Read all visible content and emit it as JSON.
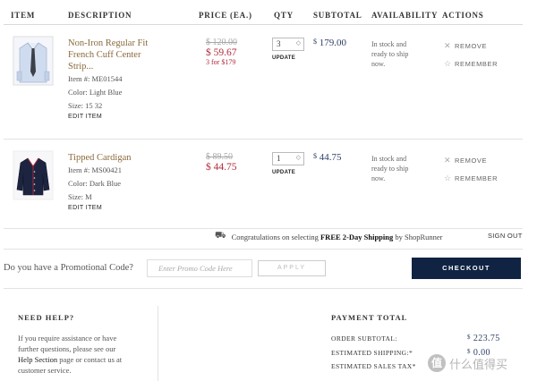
{
  "headers": {
    "item": "ITEM",
    "description": "DESCRIPTION",
    "price": "PRICE (EA.)",
    "qty": "QTY",
    "subtotal": "SUBTOTAL",
    "availability": "AVAILABILITY",
    "actions": "ACTIONS"
  },
  "items": [
    {
      "name_line1": "Non-Iron Regular Fit",
      "name_line2": "French Cuff Center",
      "name_line3": "Strip...",
      "item_no": "Item #: ME01544",
      "color": "Color: Light Blue",
      "size": "Size: 15 32",
      "edit": "EDIT ITEM",
      "old_price": "$ 120.00",
      "new_price": "$ 59.67",
      "deal": "3 for $179",
      "qty": "3",
      "update": "UPDATE",
      "subtotal": "179.00",
      "avail_line1": "In stock and",
      "avail_line2": "ready to ship",
      "avail_line3": "now.",
      "remove": "REMOVE",
      "remember": "REMEMBER"
    },
    {
      "name_line1": "Tipped Cardigan",
      "item_no": "Item #: MS00421",
      "color": "Color: Dark Blue",
      "size": "Size: M",
      "edit": "EDIT ITEM",
      "old_price": "$ 89.50",
      "new_price": "$ 44.75",
      "qty": "1",
      "update": "UPDATE",
      "subtotal": "44.75",
      "avail_line1": "In stock and",
      "avail_line2": "ready to ship",
      "avail_line3": "now.",
      "remove": "REMOVE",
      "remember": "REMEMBER"
    }
  ],
  "shoprunner": {
    "pre": "Congratulations on selecting",
    "bold": "FREE 2-Day Shipping",
    "post": "by ShopRunner",
    "signout": "SIGN OUT"
  },
  "promo": {
    "label": "Do you have a Promotional Code?",
    "placeholder": "Enter Promo Code Here",
    "apply": "APPLY"
  },
  "checkout": "CHECKOUT",
  "help": {
    "title": "NEED HELP?",
    "line1": "If you require assistance or have",
    "line2": "further questions, please see our",
    "link": "Help Section",
    "line3": "page or contact us at",
    "line4": "customer service."
  },
  "payment": {
    "title": "PAYMENT TOTAL",
    "order_subtotal_label": "ORDER SUBTOTAL:",
    "order_subtotal": "223.75",
    "shipping_label": "ESTIMATED SHIPPING:*",
    "shipping": "0.00",
    "tax_label": "ESTIMATED SALES TAX*"
  },
  "currency": "$",
  "watermark": "什么值得买",
  "watermark_glyph": "值",
  "colors": {
    "accent_red": "#b02a3a",
    "navy": "#102342",
    "brand_gold": "#8a6a3a"
  }
}
